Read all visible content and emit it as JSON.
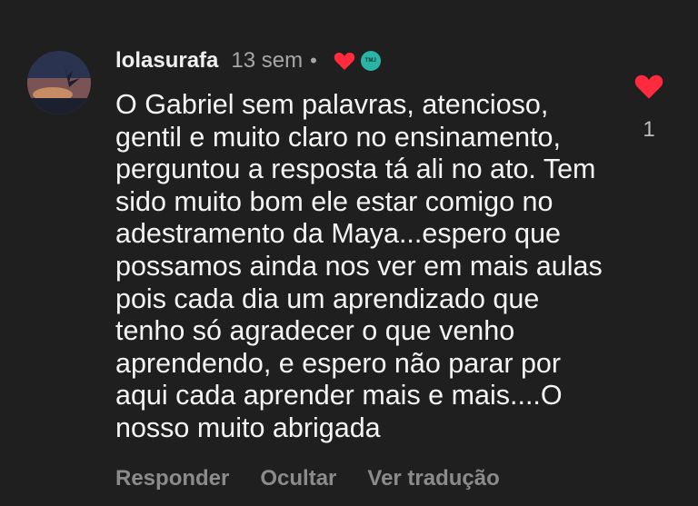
{
  "comment": {
    "username": "lolasurafa",
    "time": "13 sem",
    "separator": "•",
    "badge_text": "TMJ",
    "text": "O Gabriel sem palavras, atencioso,\ngentil e muito claro no ensinamento,\nperguntou a resposta tá ali no ato. Tem\nsido muito bom ele estar comigo no\nadestramento da Maya...espero que\npossamos ainda nos ver em mais aulas\npois cada dia um aprendizado que\ntenho só agradecer o que venho\naprendendo, e espero não parar por\naqui cada aprender mais e mais....O\nnosso muito abrigada",
    "actions": {
      "reply": "Responder",
      "hide": "Ocultar",
      "translate": "Ver tradução"
    },
    "like_count": "1"
  },
  "colors": {
    "background": "#1f1f1f",
    "heart": "#ff2a3d",
    "badge": "#2bb3a5",
    "muted": "#8b8b8b"
  },
  "icons": {
    "author_like": "heart-icon",
    "like": "heart-icon",
    "avatar": "avatar-image"
  }
}
